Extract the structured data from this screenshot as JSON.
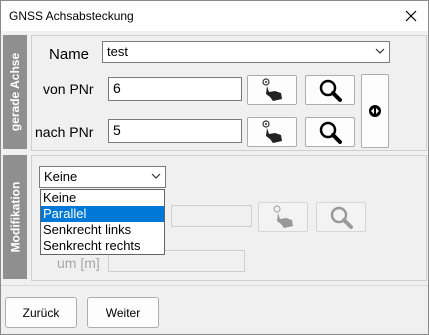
{
  "window": {
    "title": "GNSS Achsabsteckung",
    "close_icon": "close-icon"
  },
  "section1": {
    "tab_label": "gerade Achse",
    "name_label": "Name",
    "name_value": "test",
    "von_label": "von PNr",
    "von_value": "6",
    "nach_label": "nach PNr",
    "nach_value": "5"
  },
  "section2": {
    "tab_label": "Modifikation",
    "combo_value": "Keine",
    "options": [
      "Keine",
      "Parallel",
      "Senkrecht links",
      "Senkrecht rechts"
    ],
    "highlighted_option": "Parallel",
    "um_label": "um [m]"
  },
  "footer": {
    "back_label": "Zurück",
    "next_label": "Weiter"
  },
  "colors": {
    "tab_bg": "#8f8f8f",
    "selection": "#0078d7"
  }
}
